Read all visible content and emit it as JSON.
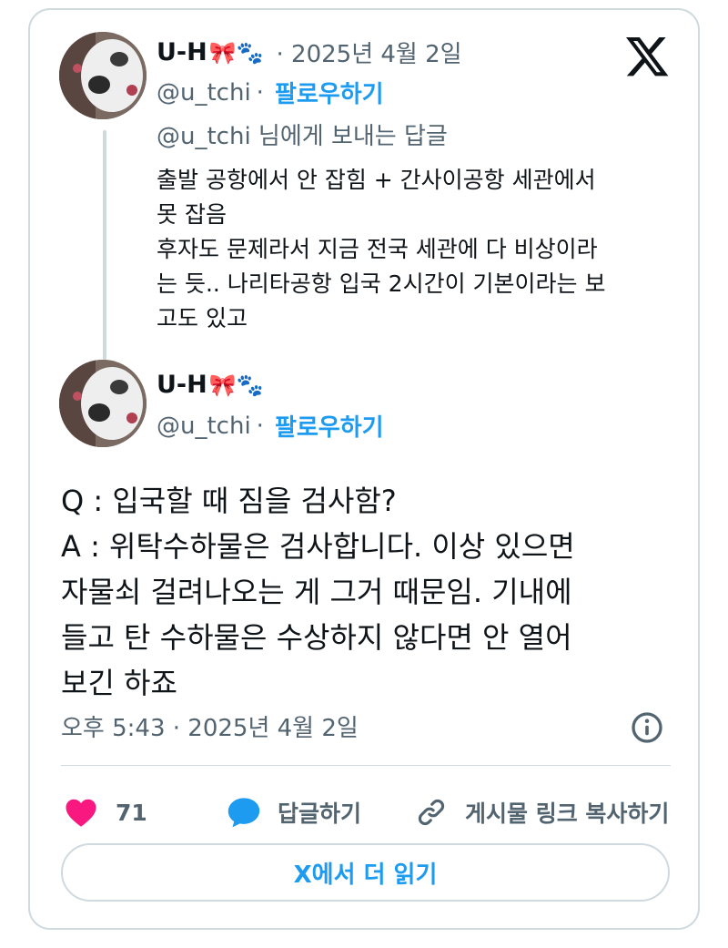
{
  "tweet_parent": {
    "author_name": "U-H",
    "name_emojis": "🎀🐾",
    "date": "· 2025년 4월 2일",
    "handle": "@u_tchi",
    "separator": "·",
    "follow_label": "팔로우하기",
    "reply_mention": "@u_tchi",
    "reply_suffix": " 님에게 보내는 답글",
    "text_lines": [
      "출발 공항에서 안 잡힘 + 간사이공항 세관에서",
      "못 잡음",
      "후자도 문제라서 지금 전국 세관에 다 비상이라",
      "는 듯.. 나리타공항 입국 2시간이 기본이라는 보",
      "고도 있고"
    ]
  },
  "tweet_main": {
    "author_name": "U-H",
    "name_emojis": "🎀🐾",
    "handle": "@u_tchi",
    "separator": "·",
    "follow_label": "팔로우하기",
    "text_lines": [
      "Q : 입국할 때 짐을 검사함?",
      "A : 위탁수하물은 검사합니다. 이상 있으면",
      "자물쇠 걸려나오는 게 그거 때문임. 기내에",
      "들고 탄 수하물은 수상하지 않다면 안 열어",
      "보긴 하죠"
    ],
    "timestamp": "오후 5:43 · 2025년 4월 2일"
  },
  "actions": {
    "like_count": "71",
    "reply_label": "답글하기",
    "copy_link_label": "게시물 링크 복사하기"
  },
  "read_more_label": "X에서 더 읽기",
  "icons": {
    "brand": "x-logo-icon",
    "info": "info-icon",
    "like": "heart-icon",
    "reply": "speech-bubble-icon",
    "link": "link-icon"
  },
  "colors": {
    "accent": "#1d9bf0",
    "like": "#f91880",
    "muted": "#536471",
    "border": "#cfd9de"
  }
}
